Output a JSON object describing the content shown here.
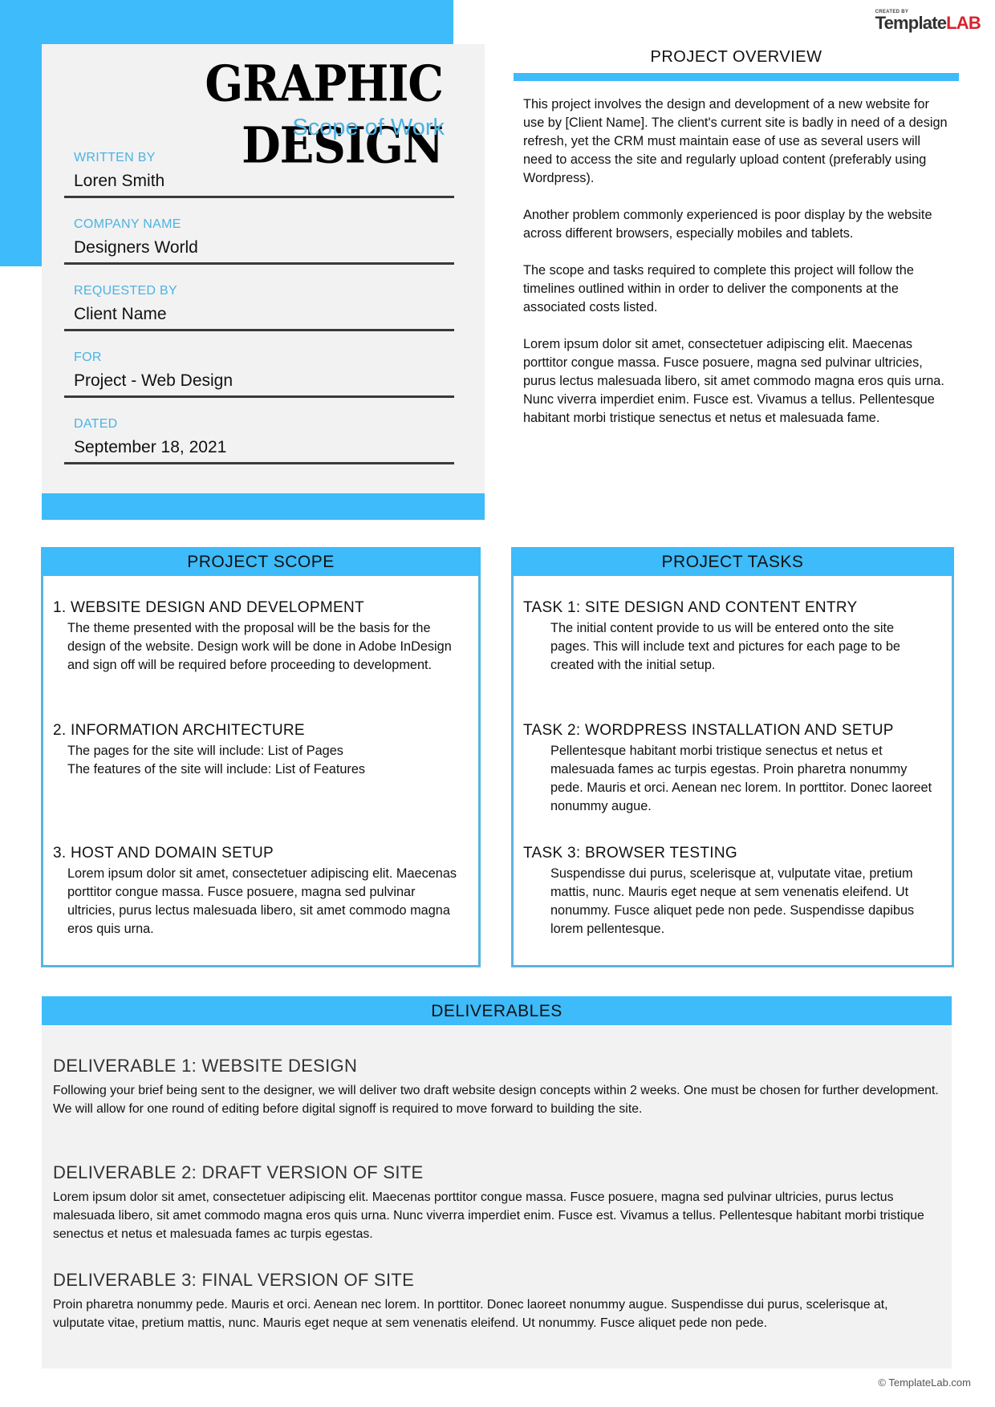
{
  "brand": {
    "created_by": "CREATED BY",
    "name_part1": "Template",
    "name_part2": "LAB",
    "accent_color": "#3dbbfa",
    "logo_red": "#d9232e"
  },
  "header": {
    "title": "GRAPHIC DESIGN",
    "subtitle": "Scope of Work",
    "fields": [
      {
        "label": "WRITTEN BY",
        "value": "Loren Smith"
      },
      {
        "label": "COMPANY NAME",
        "value": "Designers World"
      },
      {
        "label": "REQUESTED BY",
        "value": "Client Name"
      },
      {
        "label": "FOR",
        "value": "Project - Web Design"
      },
      {
        "label": "DATED",
        "value": "September 18, 2021"
      }
    ]
  },
  "overview": {
    "heading": "PROJECT OVERVIEW",
    "paragraphs": [
      "This project involves the design and development of a new website for use by [Client Name]. The client's current site is badly in need of a design refresh, yet the CRM must maintain ease of use as several users will need to access the site and regularly upload content (preferably using Wordpress).",
      "Another problem commonly experienced is poor display by the website across different browsers, especially mobiles and tablets.",
      "The scope and tasks required to complete this project will follow the timelines outlined within in order to deliver the components at the associated costs listed.",
      "Lorem ipsum dolor sit amet, consectetuer adipiscing elit. Maecenas porttitor congue massa. Fusce posuere, magna sed pulvinar ultricies, purus lectus malesuada libero, sit amet commodo magna eros quis urna. Nunc viverra imperdiet enim. Fusce est. Vivamus a tellus. Pellentesque habitant morbi tristique senectus et netus et malesuada fame."
    ]
  },
  "scope": {
    "heading": "PROJECT SCOPE",
    "items": [
      {
        "title": "1. WEBSITE DESIGN AND DEVELOPMENT",
        "body": "The theme presented with the proposal will be the basis for the design of the website.  Design work will be done in Adobe InDesign and sign off will be required before proceeding to development."
      },
      {
        "title": "2. INFORMATION ARCHITECTURE",
        "body_lines": [
          "The pages for the site will include: List of Pages",
          "The features of the site will include: List of Features"
        ]
      },
      {
        "title": "3. HOST AND DOMAIN SETUP",
        "body": "Lorem ipsum dolor sit amet, consectetuer adipiscing elit. Maecenas porttitor congue massa. Fusce posuere, magna sed pulvinar ultricies, purus lectus malesuada libero, sit amet commodo magna eros quis urna."
      }
    ]
  },
  "tasks": {
    "heading": "PROJECT TASKS",
    "items": [
      {
        "title": "TASK 1: SITE DESIGN AND CONTENT ENTRY",
        "body": "The initial content provide to us will be entered onto the site pages. This will include text and pictures for each page to be created with the initial setup."
      },
      {
        "title": "TASK 2: WORDPRESS INSTALLATION AND SETUP",
        "body": "Pellentesque habitant morbi tristique senectus et netus et malesuada fames ac turpis egestas. Proin pharetra nonummy pede. Mauris et orci. Aenean nec lorem. In porttitor. Donec laoreet nonummy augue."
      },
      {
        "title": "TASK 3: BROWSER TESTING",
        "body": "Suspendisse dui purus, scelerisque at, vulputate vitae, pretium mattis, nunc. Mauris eget neque at sem venenatis eleifend. Ut nonummy. Fusce aliquet pede non pede. Suspendisse dapibus lorem pellentesque."
      }
    ]
  },
  "deliverables": {
    "heading": "DELIVERABLES",
    "items": [
      {
        "title": "DELIVERABLE 1: WEBSITE DESIGN",
        "body": "Following your brief being sent to the designer, we will deliver two draft website design concepts within 2 weeks. One must be chosen for further development. We will allow for one round of editing before digital signoff is required to move forward to building the site."
      },
      {
        "title": "DELIVERABLE 2: DRAFT VERSION OF SITE",
        "body": "Lorem ipsum dolor sit amet, consectetuer adipiscing elit. Maecenas porttitor congue massa. Fusce posuere, magna sed pulvinar ultricies, purus lectus malesuada libero, sit amet commodo magna eros quis urna. Nunc viverra imperdiet enim. Fusce est. Vivamus a tellus. Pellentesque habitant morbi tristique senectus et netus et malesuada fames ac turpis egestas."
      },
      {
        "title": "DELIVERABLE 3: FINAL VERSION OF SITE",
        "body": "Proin pharetra nonummy pede. Mauris et orci. Aenean nec lorem. In porttitor. Donec laoreet nonummy augue. Suspendisse dui purus, scelerisque at, vulputate vitae, pretium mattis, nunc. Mauris eget neque at sem venenatis eleifend. Ut nonummy. Fusce aliquet pede non pede."
      }
    ]
  },
  "footer": {
    "copyright": "© TemplateLab.com"
  }
}
